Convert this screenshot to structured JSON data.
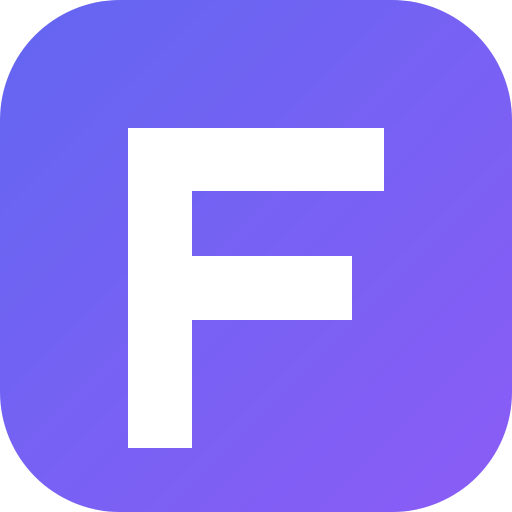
{
  "icon": {
    "letter": "F",
    "gradient_start": "#6366f1",
    "gradient_end": "#8b5cf6",
    "glyph_color": "#ffffff"
  }
}
